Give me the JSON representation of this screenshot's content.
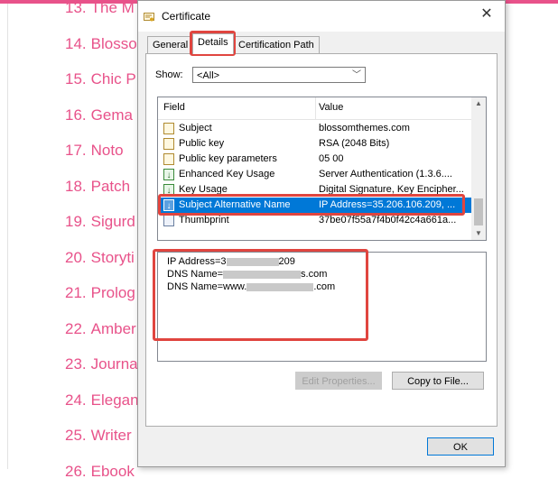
{
  "background_list": {
    "accent_color": "#e8528a",
    "items": [
      {
        "num": "13.",
        "label": "The M"
      },
      {
        "num": "14.",
        "label": "Blosso"
      },
      {
        "num": "15.",
        "label": "Chic P"
      },
      {
        "num": "16.",
        "label": "Gema"
      },
      {
        "num": "17.",
        "label": "Noto"
      },
      {
        "num": "18.",
        "label": "Patch"
      },
      {
        "num": "19.",
        "label": "Sigurd"
      },
      {
        "num": "20.",
        "label": "Storyti"
      },
      {
        "num": "21.",
        "label": "Prolog"
      },
      {
        "num": "22.",
        "label": "Amber"
      },
      {
        "num": "23.",
        "label": "Journa"
      },
      {
        "num": "24.",
        "label": "Elegan"
      },
      {
        "num": "25.",
        "label": "Writer"
      },
      {
        "num": "26.",
        "label": "Ebook"
      }
    ]
  },
  "dialog": {
    "title": "Certificate",
    "close_icon": "close-icon",
    "tabs": [
      {
        "label": "General"
      },
      {
        "label": "Details"
      },
      {
        "label": "Certification Path"
      }
    ],
    "show": {
      "label": "Show:",
      "selected": "<All>"
    },
    "fields": {
      "col_field": "Field",
      "col_value": "Value",
      "selected_color": "#0078d7",
      "rows": [
        {
          "name": "Subject",
          "value": "blossomthemes.com",
          "icon": "certificate-field-icon"
        },
        {
          "name": "Public key",
          "value": "RSA (2048 Bits)",
          "icon": "certificate-field-icon"
        },
        {
          "name": "Public key parameters",
          "value": "05 00",
          "icon": "certificate-field-icon"
        },
        {
          "name": "Enhanced Key Usage",
          "value": "Server Authentication (1.3.6....",
          "icon": "extension-field-icon"
        },
        {
          "name": "Key Usage",
          "value": "Digital Signature, Key Encipher...",
          "icon": "extension-field-icon"
        },
        {
          "name": "Subject Alternative Name",
          "value": "IP Address=35.206.106.209, ...",
          "icon": "extension-field-icon"
        },
        {
          "name": "Thumbprint",
          "value": "37be07f55a7f4b0f42c4a661a...",
          "icon": "property-field-icon"
        }
      ]
    },
    "details": {
      "line1_prefix": "IP Address=3",
      "line1_suffix": "209",
      "line2_prefix": "DNS Name=",
      "line2_suffix": "s.com",
      "line3_prefix": "DNS Name=www.",
      "line3_suffix": ".com"
    },
    "buttons": {
      "edit_properties": "Edit Properties...",
      "copy_to_file": "Copy to File...",
      "ok": "OK"
    },
    "highlight_color": "#e0453f"
  }
}
